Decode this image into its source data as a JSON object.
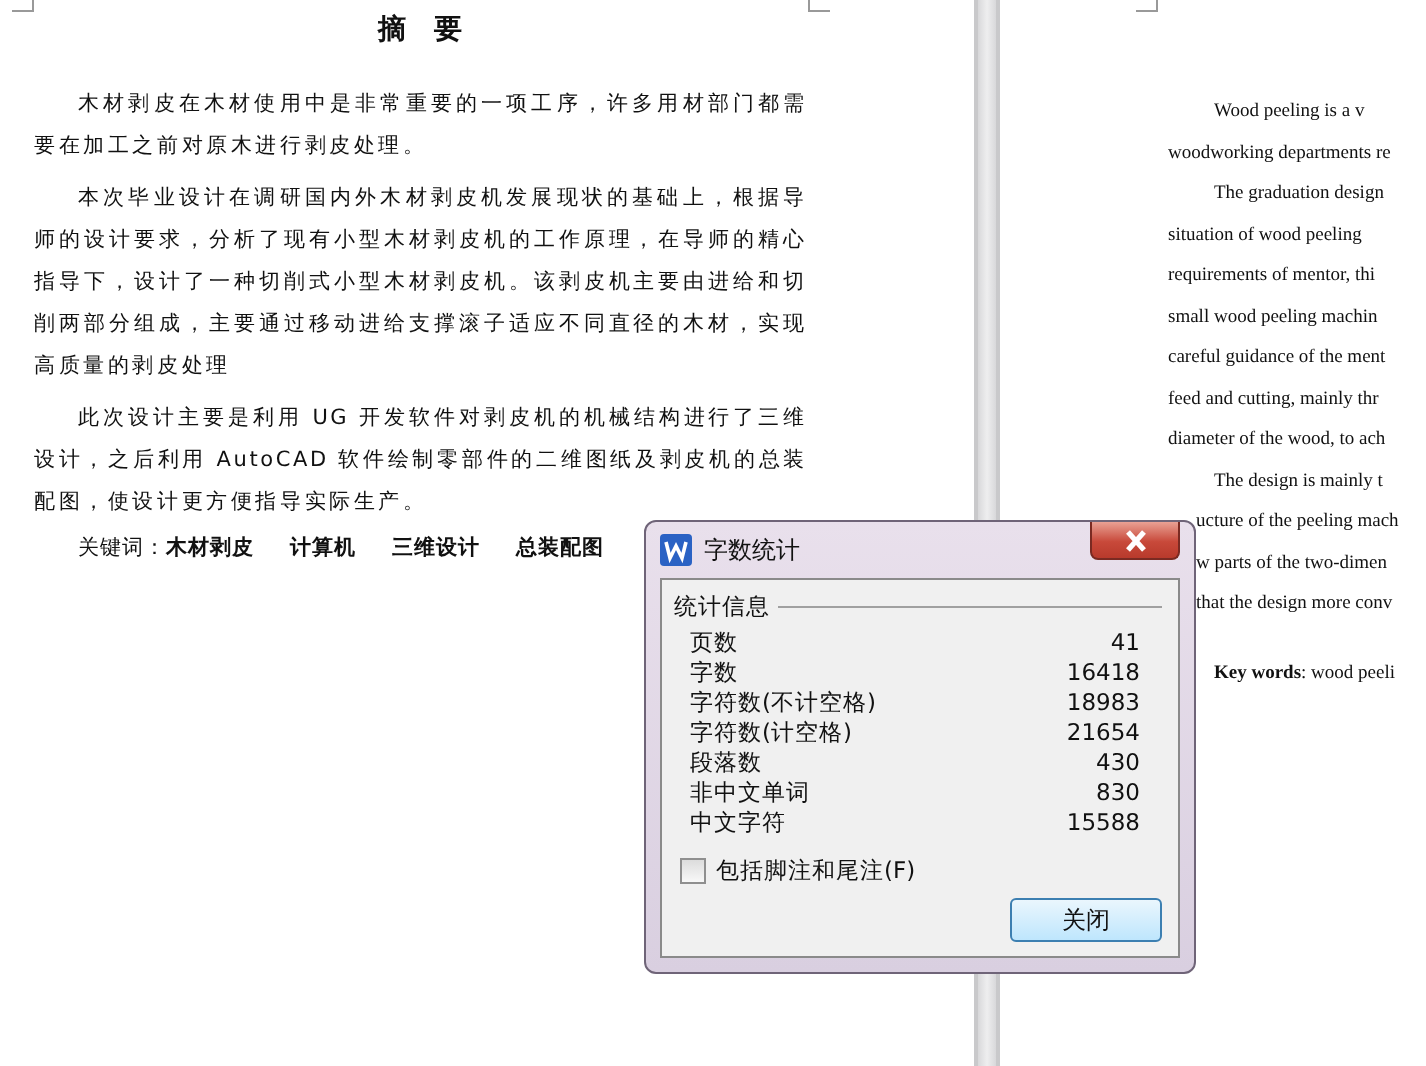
{
  "left_page": {
    "title": "摘　要",
    "paragraphs": [
      "木材剥皮在木材使用中是非常重要的一项工序，许多用材部门都需要在加工之前对原木进行剥皮处理。",
      "本次毕业设计在调研国内外木材剥皮机发展现状的基础上，根据导师的设计要求，分析了现有小型木材剥皮机的工作原理，在导师的精心指导下，设计了一种切削式小型木材剥皮机。该剥皮机主要由进给和切削两部分组成，主要通过移动进给支撑滚子适应不同直径的木材，实现高质量的剥皮处理",
      "此次设计主要是利用 UG 开发软件对剥皮机的机械结构进行了三维设计，之后利用 AutoCAD 软件绘制零部件的二维图纸及剥皮机的总装配图，使设计更方便指导实际生产。"
    ],
    "keywords_label": "关键词：",
    "keywords": [
      "木材剥皮",
      "计算机",
      "三维设计",
      "总装配图"
    ]
  },
  "right_page": {
    "lines": [
      {
        "kind": "indent",
        "text": "Wood  peeling  is  a  v"
      },
      {
        "kind": "plain",
        "text": "woodworking departments re"
      },
      {
        "kind": "indent",
        "text": "The graduation design"
      },
      {
        "kind": "plain",
        "text": "situation of wood peeling"
      },
      {
        "kind": "plain",
        "text": "requirements of mentor, thi"
      },
      {
        "kind": "plain",
        "text": "small wood peeling machin"
      },
      {
        "kind": "plain",
        "text": "careful guidance of the ment"
      },
      {
        "kind": "plain",
        "text": "feed and cutting, mainly thr"
      },
      {
        "kind": "plain",
        "text": "diameter of the wood, to ach"
      },
      {
        "kind": "indent",
        "text": "The design is mainly t"
      },
      {
        "kind": "covered",
        "text": "ucture of the peeling mach"
      },
      {
        "kind": "covered",
        "text": "w parts of the two-dimen"
      },
      {
        "kind": "covered",
        "text": "that the design more conv"
      },
      {
        "kind": "keywords",
        "text": "**Key words**: wood peeli"
      }
    ]
  },
  "dialog": {
    "title": "字数统计",
    "group_label": "统计信息",
    "stats": [
      {
        "label": "页数",
        "value": "41"
      },
      {
        "label": "字数",
        "value": "16418"
      },
      {
        "label": "字符数(不计空格)",
        "value": "18983"
      },
      {
        "label": "字符数(计空格)",
        "value": "21654"
      },
      {
        "label": "段落数",
        "value": "430"
      },
      {
        "label": "非中文单词",
        "value": "830"
      },
      {
        "label": "中文字符",
        "value": "15588"
      }
    ],
    "checkbox": {
      "label": "包括脚注和尾注(F)",
      "checked": false
    },
    "close_button": "关闭"
  }
}
